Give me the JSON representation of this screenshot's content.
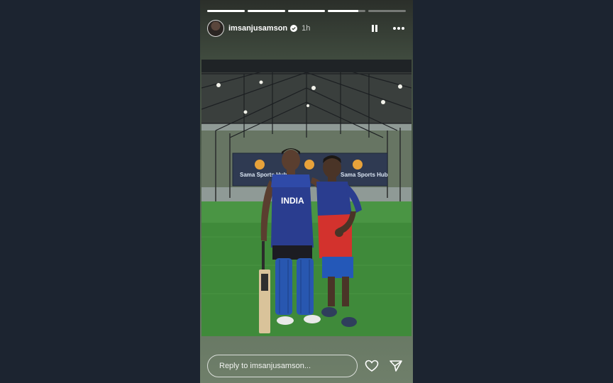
{
  "story": {
    "progress": [
      1.0,
      1.0,
      1.0,
      0.8,
      0.0
    ],
    "username": "imsanjusamson",
    "time": "1h",
    "verified": true
  },
  "header_icons": [
    "pause-icon",
    "more-icon"
  ],
  "photo": {
    "banner_left": "Sama Sports Hub",
    "banner_right": "Sama Sports Hub",
    "jersey_text": "INDIA"
  },
  "reply": {
    "placeholder": "Reply to imsanjusamson..."
  },
  "footer_icons": [
    "heart-icon",
    "send-icon"
  ],
  "colors": {
    "page_bg": "#1c2430",
    "turf": "#3f8a3a",
    "jersey_blue": "#2a3d8f",
    "jersey_red": "#d3322d"
  }
}
